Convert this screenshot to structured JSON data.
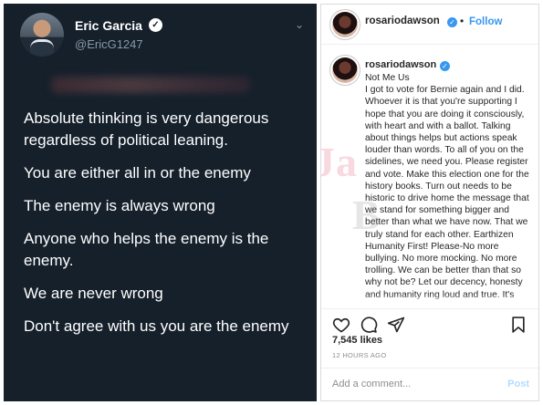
{
  "tweet": {
    "display_name": "Eric Garcia",
    "handle": "@EricG1247",
    "verified_icon": "verified-check-icon",
    "lines": [
      "Absolute thinking is very dangerous regardless of political leaning.",
      "You are either all in or the enemy",
      "The enemy is always wrong",
      "Anyone who helps the enemy is the enemy.",
      "We are never wrong",
      "Don't agree with us you are the enemy"
    ]
  },
  "instagram": {
    "username": "rosariodawson",
    "follow_label": "Follow",
    "separator": "•",
    "accent_color": "#3897f0",
    "caption_username": "rosariodawson",
    "caption_lines": [
      "Not Me Us",
      "I got to vote for Bernie again and I did. Whoever it is that you're supporting I hope that you are doing it consciously, with heart and with a ballot. Talking about things helps but actions speak louder than words. To all of you on the sidelines, we need you. Please register and vote. Make this election one for the history books. Turn out needs to be historic to drive home the message that we stand for something bigger and better than what we have now. That we truly stand for each other. Earthizen Humanity First! Please-No more bullying. No more mocking. No more trolling. We can be better than that so why not be? Let our decency, honesty and humanity ring loud and true. It's"
    ],
    "watermark_line1": "Ja",
    "watermark_line2": "B",
    "likes": "7,545 likes",
    "timestamp": "12 HOURS AGO",
    "comment_placeholder": "Add a comment...",
    "post_label": "Post"
  }
}
